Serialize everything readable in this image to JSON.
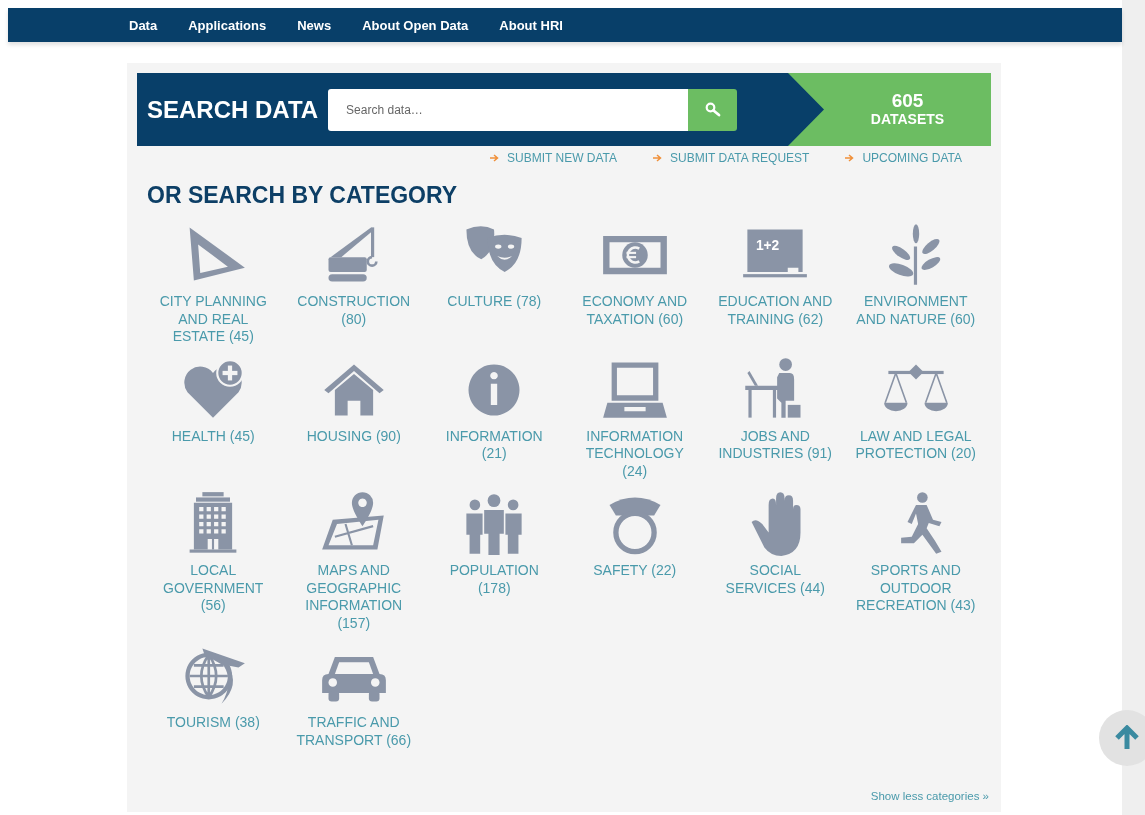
{
  "nav": [
    {
      "label": "Data"
    },
    {
      "label": "Applications"
    },
    {
      "label": "News"
    },
    {
      "label": "About Open Data"
    },
    {
      "label": "About HRI"
    }
  ],
  "search": {
    "title": "SEARCH DATA",
    "placeholder": "Search data…",
    "count": "605",
    "count_label": "DATASETS"
  },
  "links": [
    {
      "label": "SUBMIT NEW DATA"
    },
    {
      "label": "SUBMIT DATA REQUEST"
    },
    {
      "label": "UPCOMING DATA"
    }
  ],
  "heading": "OR SEARCH BY CATEGORY",
  "categories": [
    {
      "label": "CITY PLANNING AND REAL ESTATE (45)"
    },
    {
      "label": "CONSTRUCTION (80)"
    },
    {
      "label": "CULTURE (78)"
    },
    {
      "label": "ECONOMY AND TAXATION (60)"
    },
    {
      "label": "EDUCATION AND TRAINING (62)",
      "board_text": "1+2"
    },
    {
      "label": "ENVIRONMENT AND NATURE (60)"
    },
    {
      "label": "HEALTH (45)"
    },
    {
      "label": "HOUSING (90)"
    },
    {
      "label": "INFORMATION (21)"
    },
    {
      "label": "INFORMATION TECHNOLOGY (24)"
    },
    {
      "label": "JOBS AND INDUSTRIES (91)"
    },
    {
      "label": "LAW AND LEGAL PROTECTION (20)"
    },
    {
      "label": "LOCAL GOVERNMENT (56)"
    },
    {
      "label": "MAPS AND GEOGRAPHIC INFORMATION (157)"
    },
    {
      "label": "POPULATION (178)"
    },
    {
      "label": "SAFETY (22)"
    },
    {
      "label": "SOCIAL SERVICES (44)"
    },
    {
      "label": "SPORTS AND OUTDOOR RECREATION (43)"
    },
    {
      "label": "TOURISM (38)"
    },
    {
      "label": "TRAFFIC AND TRANSPORT (66)"
    }
  ],
  "show_less": "Show less categories »"
}
